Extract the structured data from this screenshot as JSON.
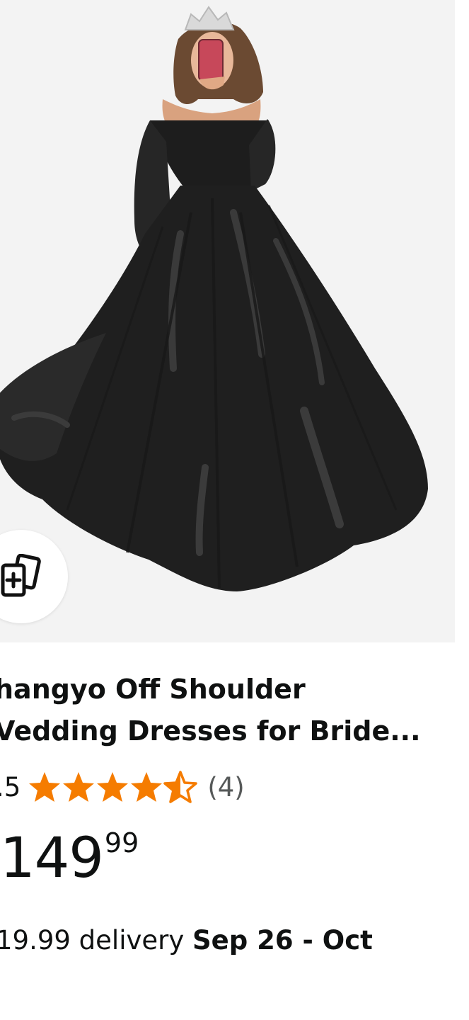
{
  "product": {
    "title_line1": "hangyo Off Shoulder",
    "title_line2": "Vedding Dresses for Bride...",
    "rating_value": ".5",
    "rating_stars": 4.5,
    "review_count": "(4)",
    "price_whole": "149",
    "price_fraction": "99",
    "delivery_prefix": "19.99 delivery ",
    "delivery_dates": "Sep 26 - Oct"
  },
  "icons": {
    "compare": "add-to-compare-icon",
    "star": "star-icon"
  },
  "colors": {
    "star": "#F57C00",
    "text": "#0F1111",
    "secondary_text": "#565959",
    "image_bg": "#F3F3F3",
    "dress": "#1F1F1F"
  }
}
